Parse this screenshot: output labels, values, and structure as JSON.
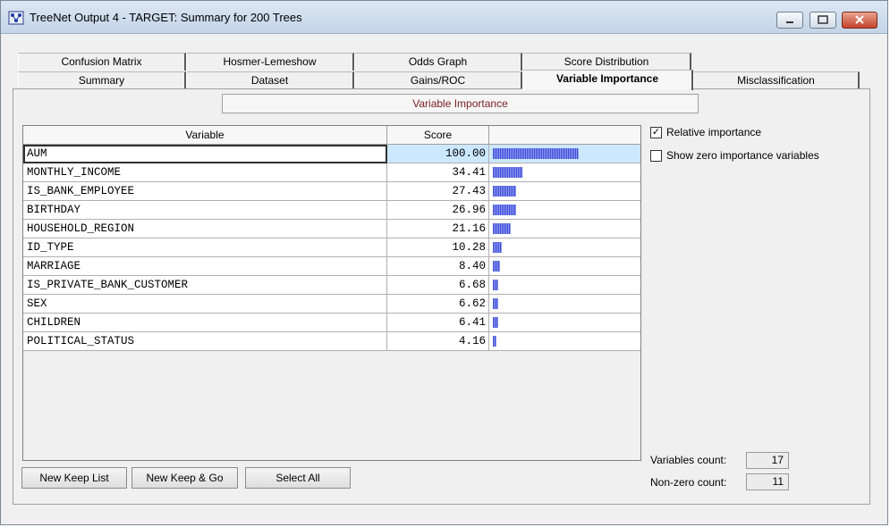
{
  "window": {
    "title": "TreeNet Output 4 - TARGET: Summary for 200 Trees"
  },
  "tabs": {
    "row1": [
      "Confusion Matrix",
      "Hosmer-Lemeshow",
      "Odds Graph",
      "Score Distribution"
    ],
    "row2": [
      "Summary",
      "Dataset",
      "Gains/ROC",
      "Variable Importance",
      "Misclassification"
    ],
    "active": "Variable Importance"
  },
  "panel": {
    "section_label": "Variable Importance"
  },
  "table": {
    "headers": [
      "Variable",
      "Score",
      ""
    ],
    "rows": [
      {
        "variable": "AUM",
        "score": "100.00",
        "bar_fraction": 1.0
      },
      {
        "variable": "MONTHLY_INCOME",
        "score": "34.41",
        "bar_fraction": 0.3441
      },
      {
        "variable": "IS_BANK_EMPLOYEE",
        "score": "27.43",
        "bar_fraction": 0.2743
      },
      {
        "variable": "BIRTHDAY",
        "score": "26.96",
        "bar_fraction": 0.2696
      },
      {
        "variable": "HOUSEHOLD_REGION",
        "score": "21.16",
        "bar_fraction": 0.2116
      },
      {
        "variable": "ID_TYPE",
        "score": "10.28",
        "bar_fraction": 0.1028
      },
      {
        "variable": "MARRIAGE",
        "score": "8.40",
        "bar_fraction": 0.084
      },
      {
        "variable": "IS_PRIVATE_BANK_CUSTOMER",
        "score": "6.68",
        "bar_fraction": 0.0668
      },
      {
        "variable": "SEX",
        "score": "6.62",
        "bar_fraction": 0.0662
      },
      {
        "variable": "CHILDREN",
        "score": "6.41",
        "bar_fraction": 0.0641
      },
      {
        "variable": "POLITICAL_STATUS",
        "score": "4.16",
        "bar_fraction": 0.0416
      }
    ],
    "selected_row": 0,
    "bar_color": "#3c4bd8"
  },
  "options": {
    "relative_importance": {
      "label": "Relative importance",
      "checked": true,
      "mark": "✓"
    },
    "show_zero": {
      "label": "Show zero importance variables",
      "checked": false,
      "mark": ""
    }
  },
  "buttons": {
    "new_keep_list": "New Keep List",
    "new_keep_go": "New Keep & Go",
    "select_all": "Select All"
  },
  "counts": {
    "variables_label": "Variables count:",
    "variables_value": "17",
    "nonzero_label": "Non-zero count:",
    "nonzero_value": "11"
  },
  "icons": {
    "app": "treenet-app-icon",
    "minimize": "minimize-icon",
    "maximize": "maximize-icon",
    "close": "close-icon"
  }
}
